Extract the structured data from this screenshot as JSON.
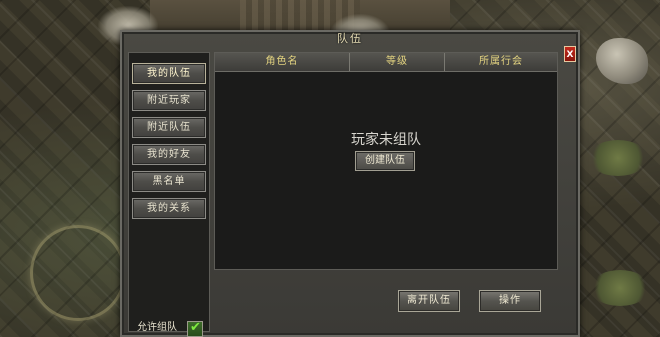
{
  "window": {
    "title": "队伍",
    "close_label": "X"
  },
  "nav": {
    "items": [
      {
        "label": "我的队伍",
        "active": true
      },
      {
        "label": "附近玩家",
        "active": false
      },
      {
        "label": "附近队伍",
        "active": false
      },
      {
        "label": "我的好友",
        "active": false
      },
      {
        "label": "黑名单",
        "active": false
      },
      {
        "label": "我的关系",
        "active": false
      }
    ]
  },
  "table": {
    "columns": [
      "角色名",
      "等级",
      "所属行会"
    ]
  },
  "content": {
    "empty_message": "玩家未组队",
    "create_team_label": "创建队伍"
  },
  "settings": {
    "allow_team_label": "允许组队",
    "allow_team_checked": true
  },
  "actions": {
    "leave_team_label": "离开队伍",
    "operate_label": "操作"
  },
  "colors": {
    "header_text": "#e4d480",
    "check_green": "#7eea3f",
    "close_red": "#c32a1c"
  }
}
